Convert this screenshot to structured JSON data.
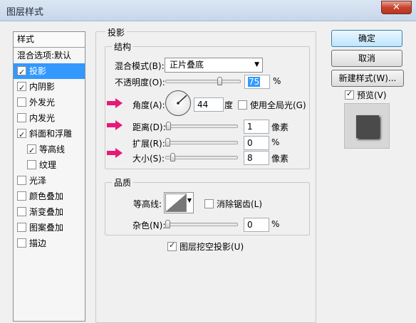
{
  "window": {
    "title": "图层样式",
    "close_glyph": "✕"
  },
  "styles_panel": {
    "header": "样式",
    "items": [
      {
        "label": "混合选项:默认",
        "checkbox": false,
        "checked": false,
        "selected": false,
        "sub": false
      },
      {
        "label": "投影",
        "checkbox": true,
        "checked": true,
        "selected": true,
        "sub": false
      },
      {
        "label": "内阴影",
        "checkbox": true,
        "checked": true,
        "selected": false,
        "sub": false
      },
      {
        "label": "外发光",
        "checkbox": true,
        "checked": false,
        "selected": false,
        "sub": false
      },
      {
        "label": "内发光",
        "checkbox": true,
        "checked": false,
        "selected": false,
        "sub": false
      },
      {
        "label": "斜面和浮雕",
        "checkbox": true,
        "checked": true,
        "selected": false,
        "sub": false
      },
      {
        "label": "等高线",
        "checkbox": true,
        "checked": true,
        "selected": false,
        "sub": true
      },
      {
        "label": "纹理",
        "checkbox": true,
        "checked": false,
        "selected": false,
        "sub": true
      },
      {
        "label": "光泽",
        "checkbox": true,
        "checked": false,
        "selected": false,
        "sub": false
      },
      {
        "label": "颜色叠加",
        "checkbox": true,
        "checked": false,
        "selected": false,
        "sub": false
      },
      {
        "label": "渐变叠加",
        "checkbox": true,
        "checked": false,
        "selected": false,
        "sub": false
      },
      {
        "label": "图案叠加",
        "checkbox": true,
        "checked": false,
        "selected": false,
        "sub": false
      },
      {
        "label": "描边",
        "checkbox": true,
        "checked": false,
        "selected": false,
        "sub": false
      }
    ]
  },
  "shadow": {
    "section_title": "投影",
    "structure": {
      "title": "结构",
      "blend_mode_label": "混合模式(B):",
      "blend_mode_value": "正片叠底",
      "opacity_label": "不透明度(O):",
      "opacity_value": "75",
      "opacity_unit": "%",
      "opacity_fraction": 0.75,
      "angle_label": "角度(A):",
      "angle_value": "44",
      "angle_unit": "度",
      "use_global_light_label": "使用全局光(G)",
      "use_global_light_checked": false,
      "distance_label": "距离(D):",
      "distance_value": "1",
      "distance_unit": "像素",
      "spread_label": "扩展(R):",
      "spread_value": "0",
      "spread_unit": "%",
      "size_label": "大小(S):",
      "size_value": "8",
      "size_unit": "像素"
    },
    "quality": {
      "title": "品质",
      "contour_label": "等高线:",
      "anti_alias_label": "消除锯齿(L)",
      "anti_alias_checked": false,
      "noise_label": "杂色(N):",
      "noise_value": "0",
      "noise_unit": "%"
    },
    "knockout_label": "图层挖空投影(U)",
    "knockout_checked": true
  },
  "buttons": {
    "ok": "确定",
    "cancel": "取消",
    "new_style": "新建样式(W)...",
    "preview_label": "预览(V)",
    "preview_checked": true
  },
  "colors": {
    "selection": "#3399ff",
    "annotation_arrow": "#e6197a",
    "preview_swatch": "#4a4a4a"
  }
}
